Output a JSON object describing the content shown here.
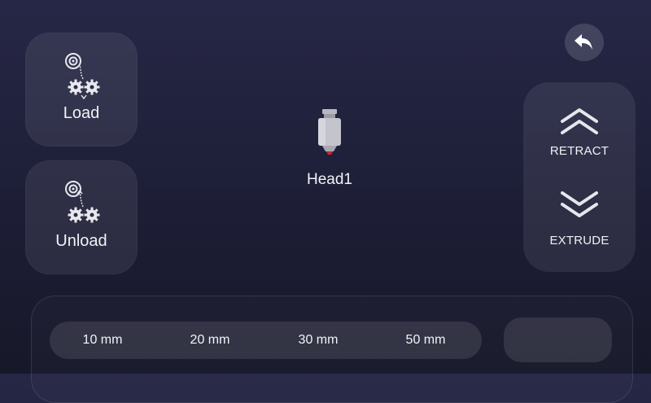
{
  "filament": {
    "load_label": "Load",
    "unload_label": "Unload",
    "load_icon": "filament-load-icon",
    "unload_icon": "filament-unload-icon"
  },
  "navigation": {
    "back_icon": "back-arrow-icon"
  },
  "head": {
    "label": "Head1",
    "icon": "nozzle-icon",
    "tip_color": "#c8253a"
  },
  "extruder": {
    "retract_label": "RETRACT",
    "extrude_label": "EXTRUDE",
    "retract_icon": "double-chevron-up-icon",
    "extrude_icon": "double-chevron-down-icon"
  },
  "distance": {
    "options": [
      "10 mm",
      "20 mm",
      "30 mm",
      "50 mm"
    ],
    "custom_value": ""
  },
  "colors": {
    "background_top": "#262746",
    "background_bottom": "#171829",
    "tile": "rgba(255,255,255,0.08)",
    "text": "#ffffff"
  }
}
